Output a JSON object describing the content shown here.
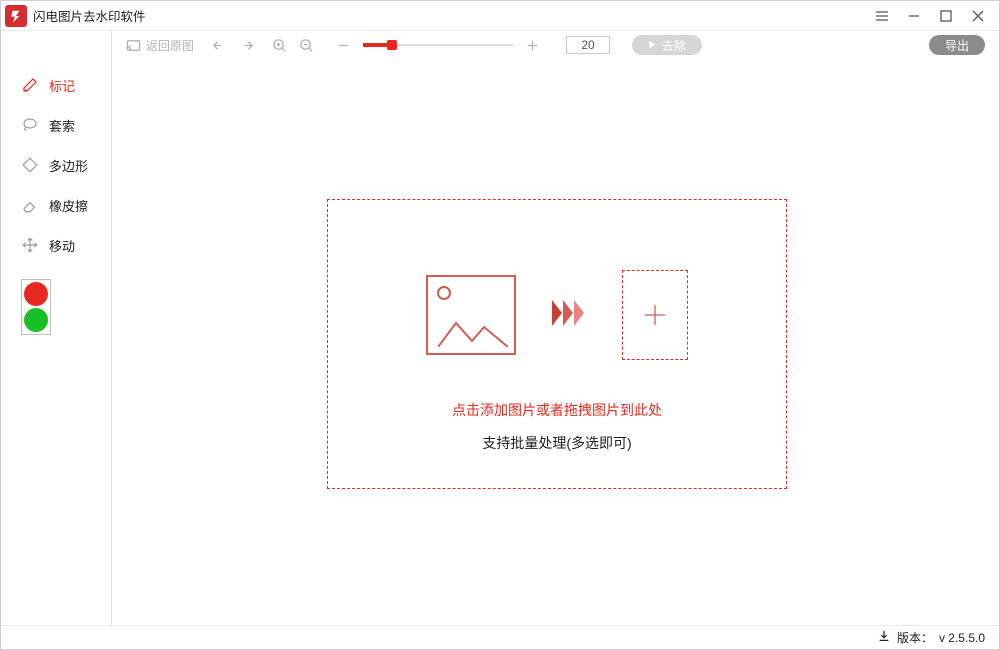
{
  "app": {
    "title": "闪电图片去水印软件"
  },
  "window_controls": {
    "menu": "menu",
    "min": "min",
    "max": "max",
    "close": "close"
  },
  "sidebar": {
    "tools": [
      {
        "id": "mark",
        "label": "标记",
        "icon": "marker-icon",
        "active": true
      },
      {
        "id": "lasso",
        "label": "套索",
        "icon": "lasso-icon",
        "active": false
      },
      {
        "id": "poly",
        "label": "多边形",
        "icon": "polygon-icon",
        "active": false
      },
      {
        "id": "eraser",
        "label": "橡皮擦",
        "icon": "eraser-icon",
        "active": false
      },
      {
        "id": "move",
        "label": "移动",
        "icon": "move-icon",
        "active": false
      }
    ],
    "swatches": [
      "#e7281f",
      "#18c024"
    ]
  },
  "toolbar": {
    "reset_label": "返回原图",
    "brush_size_value": "20",
    "remove_label": "去除",
    "export_label": "导出"
  },
  "dropzone": {
    "line1": "点击添加图片或者拖拽图片到此处",
    "line2": "支持批量处理(多选即可)"
  },
  "status": {
    "version_label": "版本：",
    "version_value": "v 2.5.5.0"
  }
}
